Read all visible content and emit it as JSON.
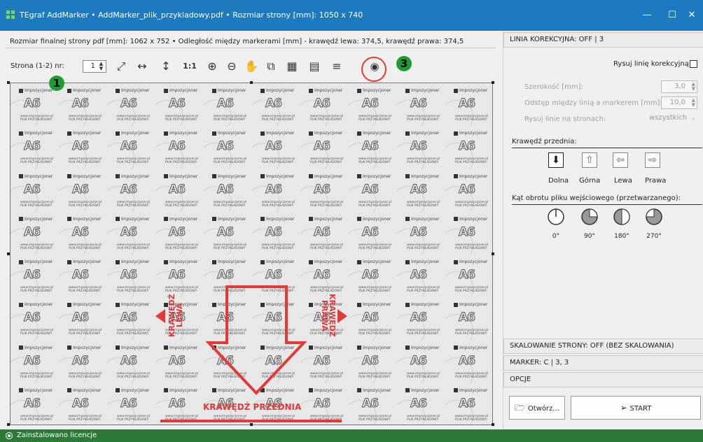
{
  "window": {
    "title": "TEgraf AddMarker • AddMarker_plik_przykladowy.pdf • Rozmiar strony [mm]: 1050 x 740",
    "minimize": "—",
    "maximize": "☐",
    "close": "✕"
  },
  "info_line": "Rozmiar finalnej strony pdf [mm]: 1062 x 752 • Odległość między markerami [mm] - krawędź lewa: 374,5, krawędź prawa: 374,5",
  "toolbar": {
    "page_label": "Strona (1-2) nr:",
    "page_value": "1",
    "icons": [
      "fit-page-icon",
      "fit-width-icon",
      "fit-height-icon",
      "actual-size-icon",
      "zoom-in-icon",
      "zoom-out-icon",
      "pan-hand-icon",
      "magnify-region-icon",
      "grid-icon",
      "single-page-icon",
      "text-markers-icon",
      "eye-preview-icon"
    ],
    "icon_glyphs": [
      "⤢",
      "↔",
      "↕",
      "1:1",
      "⊕",
      "⊖",
      "✋",
      "⧉",
      "▦",
      "▤",
      "≡",
      "◉"
    ]
  },
  "callouts": {
    "one": "1",
    "three": "3"
  },
  "preview": {
    "cell_logo_text": "Impozycjoner",
    "cell_big_text": "A6",
    "cell_url_line1": "www.impozycjoner.pl",
    "cell_url_line2": "PLIK PRZYKŁADOWY",
    "label_left": "KRAWĘDŹ LEWA",
    "label_right": "KRAWĘDŹ PRAWA",
    "label_bottom": "KRAWĘDŹ PRZEDNIA"
  },
  "right_panel": {
    "section_correction": "LINIA KOREKCYJNA: OFF | 3",
    "draw_correction_label": "Rysuj linię korekcyjną",
    "draw_correction_checked": false,
    "width_label": "Szerokość [mm]:",
    "width_value": "3,0",
    "spacing_label": "Odstęp między linią a markerem [mm]:",
    "spacing_value": "10,0",
    "pages_label": "Rysuj linie na stronach:",
    "pages_value": "wszystkich",
    "front_edge_title": "Krawędź przednia:",
    "edges": [
      {
        "label": "Dolna",
        "glyph": "⬇",
        "selected": true
      },
      {
        "label": "Górna",
        "glyph": "⇧",
        "selected": false
      },
      {
        "label": "Lewa",
        "glyph": "⇦",
        "selected": false
      },
      {
        "label": "Prawa",
        "glyph": "⇨",
        "selected": false
      }
    ],
    "rotation_title": "Kąt obrotu pliku wejściowego (przetwarzanego):",
    "rotations": [
      "0°",
      "90°",
      "180°",
      "270°"
    ],
    "section_scaling": "SKALOWANIE STRONY: OFF (BEZ SKALOWANIA)",
    "section_marker": "MARKER: C | 3, 3",
    "section_options": "OPCJE",
    "open_button": "Otwórz...",
    "start_button": "START"
  },
  "status": "Zainstalowano licencje",
  "colors": {
    "accent": "#1e7abf",
    "status_green": "#2b7a37",
    "callout_green": "#1e9b32",
    "red": "#e23a3a"
  }
}
